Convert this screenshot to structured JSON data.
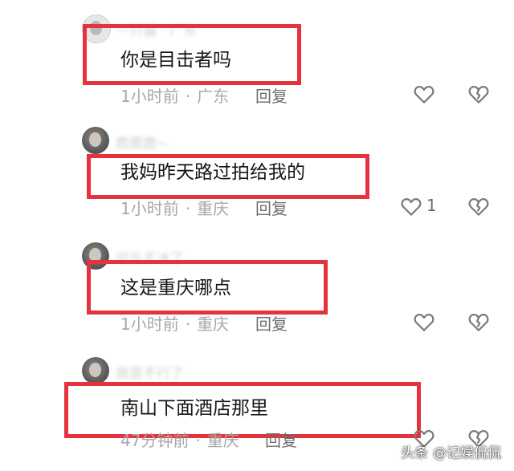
{
  "comments": [
    {
      "username": "一只猫 · 广东",
      "text": "你是目击者吗",
      "time": "1小时前",
      "location": "广东",
      "reply_label": "回复",
      "like_count": "",
      "avatar_style": "light"
    },
    {
      "username": "鹿鹿鹿~",
      "text": "我妈昨天路过拍给我的",
      "time": "1小时前",
      "location": "重庆",
      "reply_label": "回复",
      "like_count": "1",
      "avatar_style": "dark"
    },
    {
      "username": "可乐不冰了",
      "text": "这是重庆哪点",
      "time": "1小时前",
      "location": "重庆",
      "reply_label": "回复",
      "like_count": "",
      "avatar_style": "dark"
    },
    {
      "username": "我是不行了",
      "text": "南山下面酒店那里",
      "time": "47分钟前",
      "location": "重庆",
      "reply_label": "回复",
      "like_count": "",
      "avatar_style": "dark"
    }
  ],
  "watermark": {
    "platform": "头条",
    "account": "@记娱侃侃"
  },
  "colors": {
    "highlight": "#e6323c",
    "text": "#161616",
    "meta": "#a8a8a8",
    "icon": "#7a7a7a"
  },
  "icons": {
    "like": "heart-outline-icon",
    "dislike": "broken-heart-icon"
  }
}
